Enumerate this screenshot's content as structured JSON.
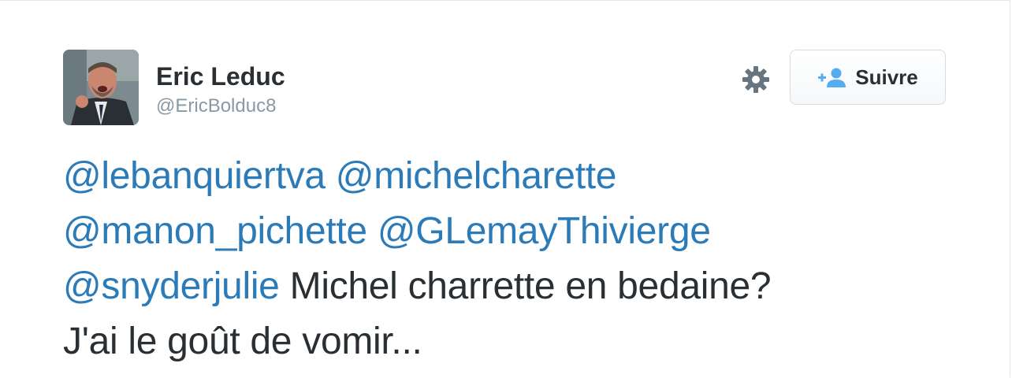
{
  "user": {
    "display_name": "Eric Leduc",
    "screen_name": "@EricBolduc8",
    "avatar_icon": "profile-photo"
  },
  "actions": {
    "settings_icon": "gear-icon",
    "follow_label": "Suivre",
    "follow_icon": "add-user-icon"
  },
  "tweet": {
    "mentions": [
      "@lebanquiertva",
      "@michelcharette",
      "@manon_pichette",
      "@GLemayThivierge",
      "@snyderjulie"
    ],
    "text_line1": "Michel charrette en bedaine?",
    "text_line2": "J'ai le goût de vomir..."
  },
  "colors": {
    "link": "#2b7bb9",
    "text": "#292f33",
    "muted": "#8899a6",
    "border": "#e1e8ed"
  }
}
